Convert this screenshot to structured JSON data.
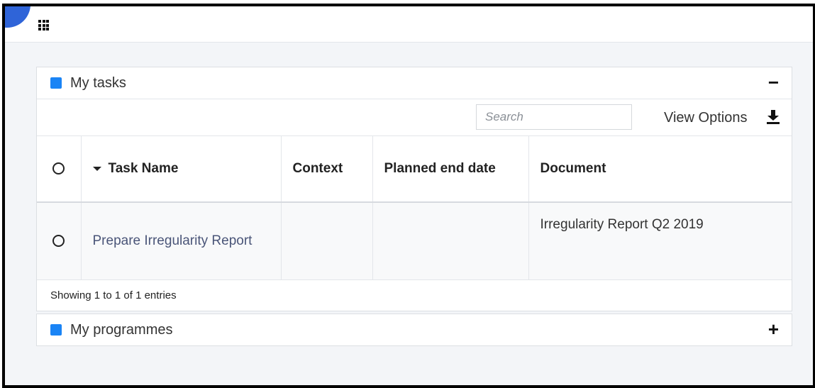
{
  "topbar": {
    "menu_icon": "menu-lines-icon",
    "apps_icon": "apps-grid-icon"
  },
  "tasks_panel": {
    "title": "My tasks",
    "toggle": "−",
    "search_placeholder": "Search",
    "view_options": "View Options",
    "download_icon": "download-icon",
    "columns": [
      "Task Name",
      "Context",
      "Planned end date",
      "Document"
    ],
    "rows": [
      {
        "task_name": "Prepare Irregularity Report",
        "context": "",
        "planned_end_date": "",
        "document": "Irregularity Report Q2 2019"
      }
    ],
    "footer": "Showing 1 to 1 of 1 entries"
  },
  "programmes_panel": {
    "title": "My programmes",
    "toggle": "+"
  },
  "colors": {
    "accent_square": "#1a84f5",
    "fab": "#2f64d8",
    "link": "#4a5578"
  }
}
